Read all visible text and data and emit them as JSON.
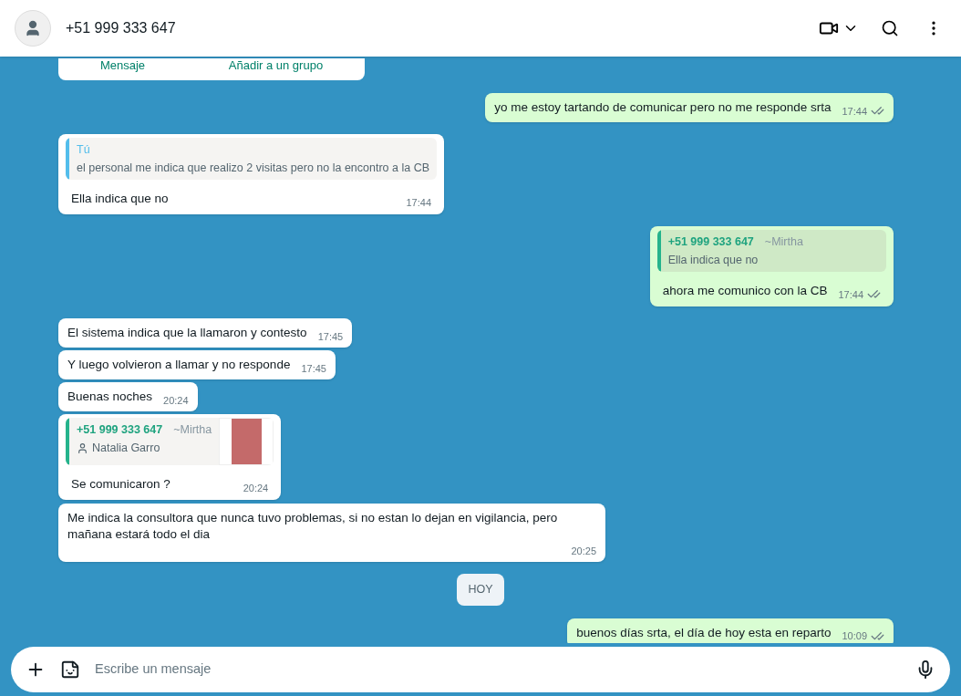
{
  "header": {
    "title": "+51 999 333 647"
  },
  "messages": [
    {
      "kind": "card",
      "actions": [
        "Mensaje",
        "Añadir a un grupo"
      ]
    },
    {
      "kind": "text",
      "outgoing": true,
      "text": "yo me estoy tartando de comunicar pero no me responde srta",
      "time": "17:44",
      "read": true
    },
    {
      "kind": "reply",
      "outgoing": false,
      "quote": {
        "author": "Tú",
        "text": "el personal me indica que realizo 2 visitas pero no la encontro a la CB"
      },
      "text": "Ella indica que no",
      "time": "17:44"
    },
    {
      "kind": "reply",
      "outgoing": true,
      "quote": {
        "author": "+51 999 333 647",
        "note": "~Mirtha",
        "text": "Ella indica que no"
      },
      "text": "ahora me comunico con la CB",
      "time": "17:44",
      "read": true
    },
    {
      "kind": "text",
      "outgoing": false,
      "text": "El sistema indica que la llamaron y contesto",
      "time": "17:45"
    },
    {
      "kind": "text",
      "outgoing": false,
      "text": "Y luego volvieron a llamar y no responde",
      "time": "17:45"
    },
    {
      "kind": "text",
      "outgoing": false,
      "text": "Buenas noches",
      "time": "20:24"
    },
    {
      "kind": "reply",
      "outgoing": false,
      "quote": {
        "author": "+51 999 333 647",
        "note": "~Mirtha",
        "contact": "Natalia Garro",
        "thumbnail": true
      },
      "text": "Se comunicaron ?",
      "time": "20:24"
    },
    {
      "kind": "text",
      "outgoing": false,
      "text": "Me indica la consultora que nunca tuvo problemas, si no estan lo dejan en vigilancia, pero mañana estará todo el dia",
      "time": "20:25"
    },
    {
      "kind": "date",
      "label": "HOY"
    },
    {
      "kind": "text",
      "outgoing": true,
      "text": "buenos días srta, el día de hoy esta en reparto",
      "time": "10:09",
      "read": true
    }
  ],
  "composer": {
    "placeholder": "Escribe un mensaje"
  }
}
